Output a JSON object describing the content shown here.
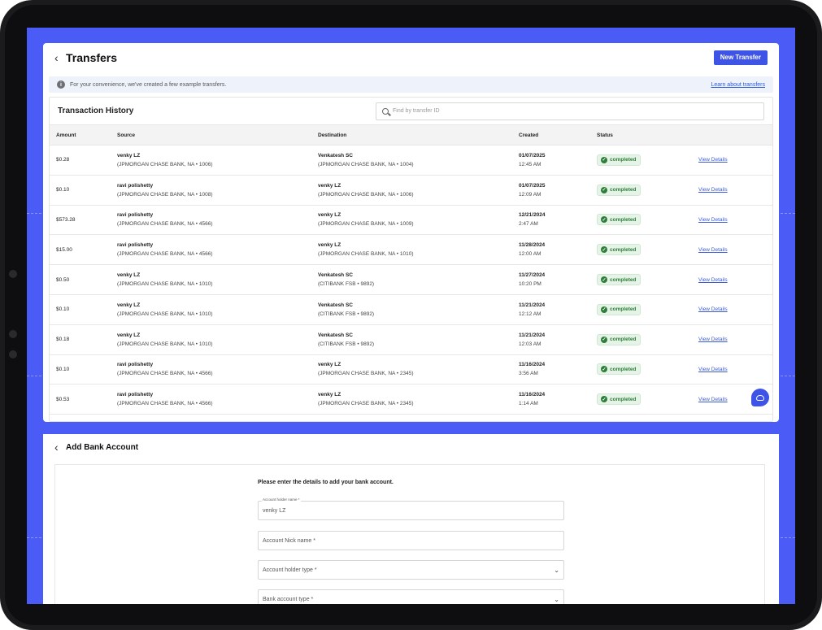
{
  "transfers": {
    "title": "Transfers",
    "new_transfer_label": "New Transfer",
    "info_text": "For your convenience, we've created a few example transfers.",
    "learn_link": "Learn about transfers",
    "history_title": "Transaction History",
    "search_placeholder": "Find by transfer ID",
    "columns": [
      "Amount",
      "Source",
      "Destination",
      "Created",
      "Status",
      ""
    ],
    "rows": [
      {
        "amount": "$0.28",
        "src_name": "venky LZ",
        "src_bank": "(JPMORGAN CHASE BANK, NA • 1006)",
        "dst_name": "Venkatesh SC",
        "dst_bank": "(JPMORGAN CHASE BANK, NA • 1004)",
        "date": "01/07/2025",
        "time": "12:45 AM",
        "status": "completed",
        "action": "View Details"
      },
      {
        "amount": "$0.10",
        "src_name": "ravi polishetty",
        "src_bank": "(JPMORGAN CHASE BANK, NA • 1008)",
        "dst_name": "venky LZ",
        "dst_bank": "(JPMORGAN CHASE BANK, NA • 1006)",
        "date": "01/07/2025",
        "time": "12:09 AM",
        "status": "completed",
        "action": "View Details"
      },
      {
        "amount": "$573.28",
        "src_name": "ravi polishetty",
        "src_bank": "(JPMORGAN CHASE BANK, NA • 4566)",
        "dst_name": "venky LZ",
        "dst_bank": "(JPMORGAN CHASE BANK, NA • 1009)",
        "date": "12/21/2024",
        "time": "2:47 AM",
        "status": "completed",
        "action": "View Details"
      },
      {
        "amount": "$15.00",
        "src_name": "ravi polishetty",
        "src_bank": "(JPMORGAN CHASE BANK, NA • 4566)",
        "dst_name": "venky LZ",
        "dst_bank": "(JPMORGAN CHASE BANK, NA • 1010)",
        "date": "11/28/2024",
        "time": "12:00 AM",
        "status": "completed",
        "action": "View Details"
      },
      {
        "amount": "$0.50",
        "src_name": "venky LZ",
        "src_bank": "(JPMORGAN CHASE BANK, NA • 1010)",
        "dst_name": "Venkatesh SC",
        "dst_bank": "(CITIBANK FSB • 9892)",
        "date": "11/27/2024",
        "time": "10:20 PM",
        "status": "completed",
        "action": "View Details"
      },
      {
        "amount": "$0.10",
        "src_name": "venky LZ",
        "src_bank": "(JPMORGAN CHASE BANK, NA • 1010)",
        "dst_name": "Venkatesh SC",
        "dst_bank": "(CITIBANK FSB • 9892)",
        "date": "11/21/2024",
        "time": "12:12 AM",
        "status": "completed",
        "action": "View Details"
      },
      {
        "amount": "$0.18",
        "src_name": "venky LZ",
        "src_bank": "(JPMORGAN CHASE BANK, NA • 1010)",
        "dst_name": "Venkatesh SC",
        "dst_bank": "(CITIBANK FSB • 9892)",
        "date": "11/21/2024",
        "time": "12:03 AM",
        "status": "completed",
        "action": "View Details"
      },
      {
        "amount": "$0.10",
        "src_name": "ravi polishetty",
        "src_bank": "(JPMORGAN CHASE BANK, NA • 4566)",
        "dst_name": "venky LZ",
        "dst_bank": "(JPMORGAN CHASE BANK, NA • 2345)",
        "date": "11/16/2024",
        "time": "3:56 AM",
        "status": "completed",
        "action": "View Details"
      },
      {
        "amount": "$0.53",
        "src_name": "ravi polishetty",
        "src_bank": "(JPMORGAN CHASE BANK, NA • 4566)",
        "dst_name": "venky LZ",
        "dst_bank": "(JPMORGAN CHASE BANK, NA • 2345)",
        "date": "11/16/2024",
        "time": "1:14 AM",
        "status": "completed",
        "action": "View Details"
      }
    ]
  },
  "add_bank": {
    "title": "Add Bank Account",
    "intro": "Please enter the details to add your bank account.",
    "holder_name_label": "Account holder name *",
    "holder_name_value": "venky LZ",
    "nick_name_placeholder": "Account Nick name *",
    "holder_type_placeholder": "Account holder type *",
    "bank_type_placeholder": "Bank account type *"
  },
  "colors": {
    "frame_bg": "#4a5cf5",
    "primary": "#3d54e6",
    "success": "#2f7d3a"
  }
}
